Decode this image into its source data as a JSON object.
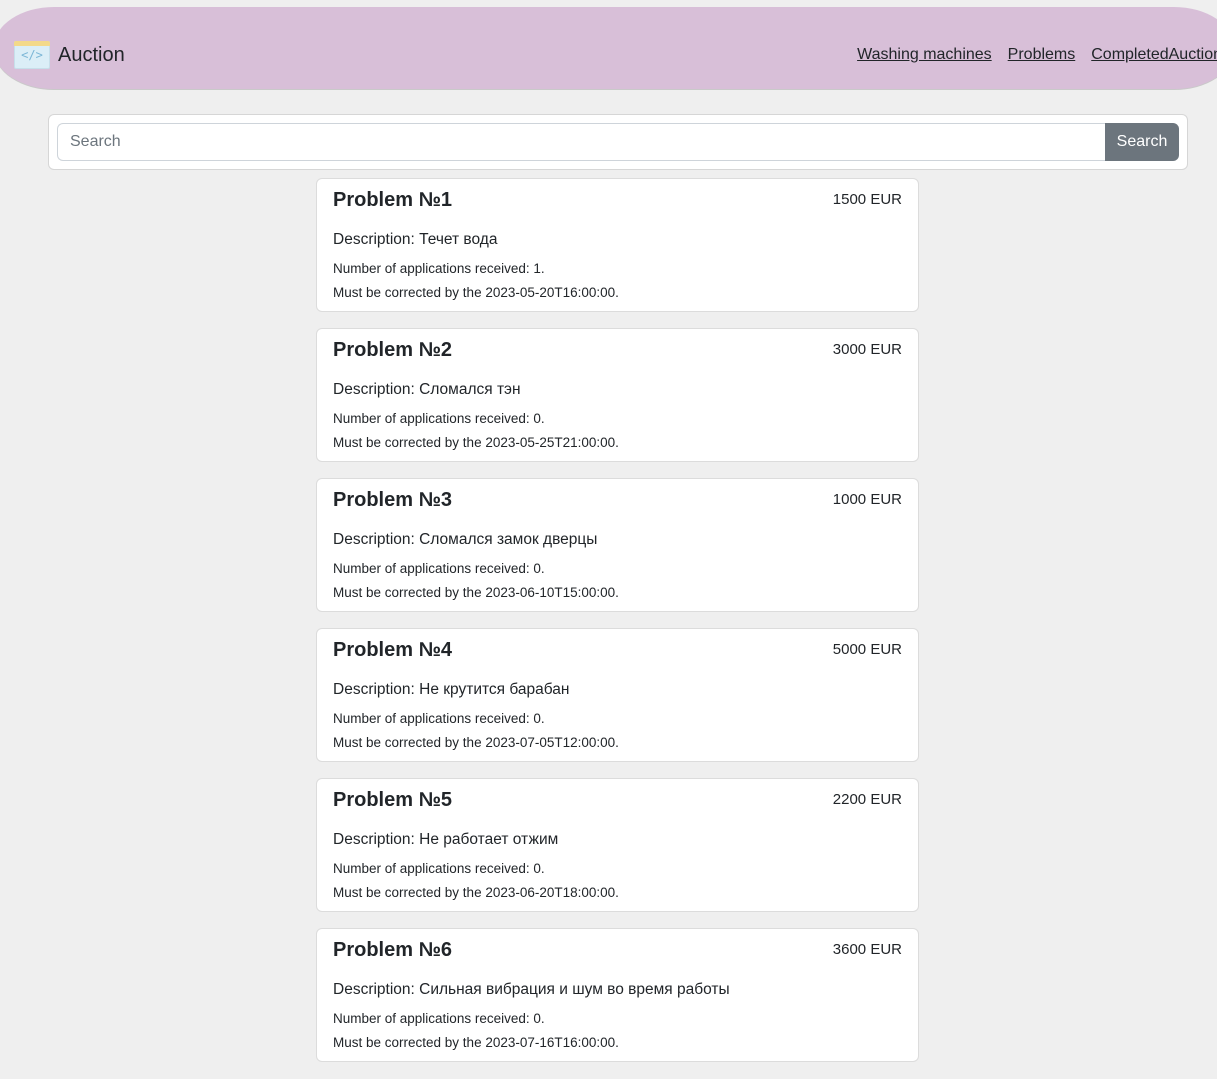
{
  "navbar": {
    "brand": "Auction",
    "brand_logo_icon": "code-window-icon",
    "links": [
      "Washing machines",
      "Problems",
      "CompletedAuction"
    ]
  },
  "search": {
    "placeholder": "Search",
    "value": "",
    "button_label": "Search"
  },
  "problems": [
    {
      "title": "Problem №1",
      "price": "1500 EUR",
      "description": "Description: Течет вода",
      "applications": "Number of applications received: 1.",
      "deadline": "Must be corrected by the 2023-05-20T16:00:00."
    },
    {
      "title": "Problem №2",
      "price": "3000 EUR",
      "description": "Description: Сломался тэн",
      "applications": "Number of applications received: 0.",
      "deadline": "Must be corrected by the 2023-05-25T21:00:00."
    },
    {
      "title": "Problem №3",
      "price": "1000 EUR",
      "description": "Description: Сломался замок дверцы",
      "applications": "Number of applications received: 0.",
      "deadline": "Must be corrected by the 2023-06-10T15:00:00."
    },
    {
      "title": "Problem №4",
      "price": "5000 EUR",
      "description": "Description: Не крутится барабан",
      "applications": "Number of applications received: 0.",
      "deadline": "Must be corrected by the 2023-07-05T12:00:00."
    },
    {
      "title": "Problem №5",
      "price": "2200 EUR",
      "description": "Description: Не работает отжим",
      "applications": "Number of applications received: 0.",
      "deadline": "Must be corrected by the 2023-06-20T18:00:00."
    },
    {
      "title": "Problem №6",
      "price": "3600 EUR",
      "description": "Description: Сильная вибрация и шум во время работы",
      "applications": "Number of applications received: 0.",
      "deadline": "Must be corrected by the 2023-07-16T16:00:00."
    }
  ]
}
